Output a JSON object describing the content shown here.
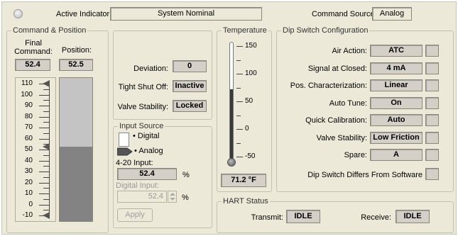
{
  "header": {
    "active_indicator_label": "Active Indicator:",
    "active_indicator_value": "System Nominal",
    "command_source_label": "Command Source:",
    "command_source_value": "Analog"
  },
  "command_position": {
    "title": "Command & Position",
    "final_command_label": "Final\nCommand:",
    "position_label": "Position:",
    "final_command_value": "52.4",
    "position_value": "52.5",
    "scale_ticks": [
      "110",
      "100",
      "90",
      "80",
      "70",
      "60",
      "50",
      "40",
      "30",
      "20",
      "10",
      "0",
      "-10"
    ],
    "command_percent": 52.4,
    "position_percent": 52.5
  },
  "status": {
    "deviation_label": "Deviation:",
    "deviation_value": "0",
    "tight_shutoff_label": "Tight Shut Off:",
    "tight_shutoff_value": "Inactive",
    "valve_stability_label": "Valve Stability:",
    "valve_stability_value": "Locked"
  },
  "input_source": {
    "title": "Input Source",
    "digital_label": "Digital",
    "analog_label": "Analog",
    "selected": "Analog",
    "input_420_label": "4-20 Input:",
    "input_420_value": "52.4",
    "input_420_unit": "%",
    "digital_input_label": "Digital Input:",
    "digital_input_value": "52.4",
    "digital_input_unit": "%",
    "apply_label": "Apply"
  },
  "temperature": {
    "title": "Temperature",
    "scale_ticks": [
      "150",
      "100",
      "50",
      "0",
      "-50"
    ],
    "value": "71.2 °F",
    "temperature_f": 71.2
  },
  "dip_switch": {
    "title": "Dip Switch Configuration",
    "rows": [
      {
        "label": "Air Action:",
        "value": "ATC"
      },
      {
        "label": "Signal at Closed:",
        "value": "4 mA"
      },
      {
        "label": "Pos. Characterization:",
        "value": "Linear"
      },
      {
        "label": "Auto Tune:",
        "value": "On"
      },
      {
        "label": "Quick Calibration:",
        "value": "Auto"
      },
      {
        "label": "Valve Stability:",
        "value": "Low Friction"
      },
      {
        "label": "Spare:",
        "value": "A"
      }
    ],
    "differs_label": "Dip Switch Differs From Software"
  },
  "hart_status": {
    "title": "HART Status",
    "transmit_label": "Transmit:",
    "transmit_value": "IDLE",
    "receive_label": "Receive:",
    "receive_value": "IDLE"
  },
  "colors": {
    "panel_bg": "#ece9d8",
    "indicator_bg": "#d4d0c8",
    "bar_fill": "#838383",
    "bar_empty": "#c4c4c4"
  }
}
